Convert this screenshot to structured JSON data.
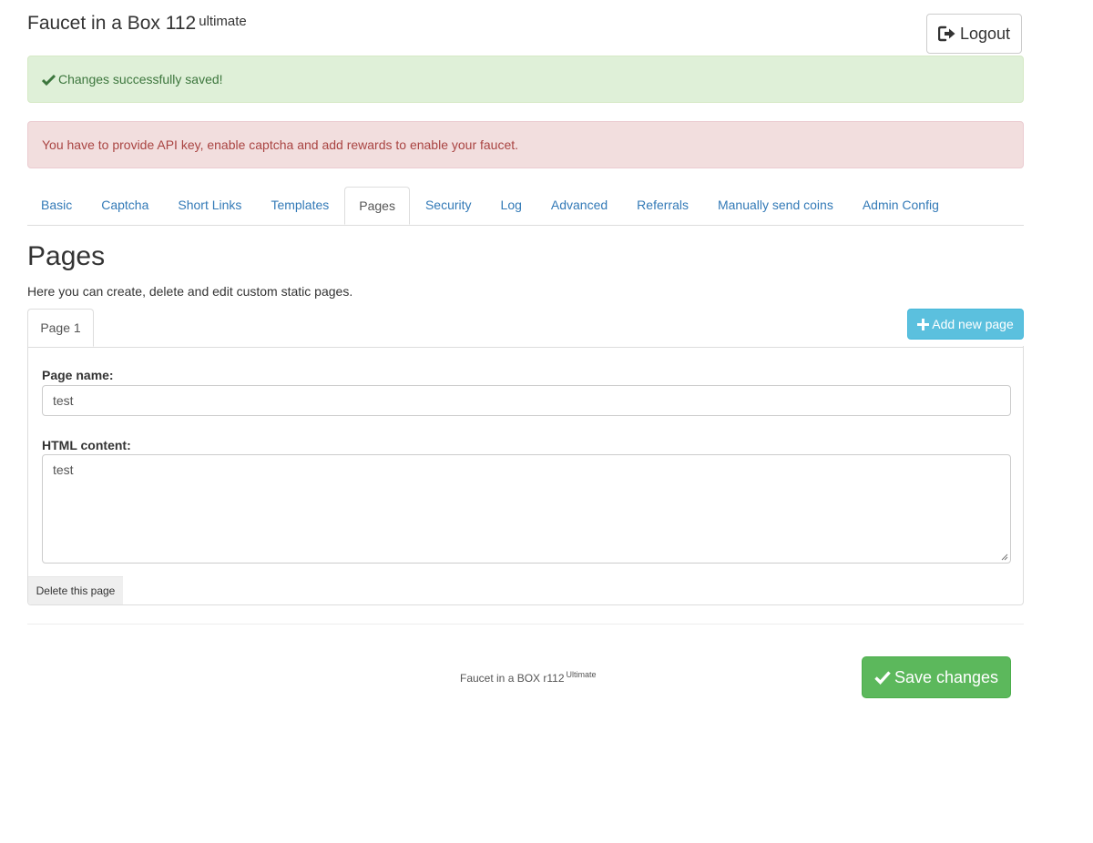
{
  "header": {
    "title": "Faucet in a Box 112",
    "title_sup": "ultimate",
    "logout_label": "Logout"
  },
  "alerts": {
    "success": "Changes successfully saved!",
    "danger": "You have to provide API key, enable captcha and add rewards to enable your faucet."
  },
  "tabs": [
    {
      "label": "Basic"
    },
    {
      "label": "Captcha"
    },
    {
      "label": "Short Links"
    },
    {
      "label": "Templates"
    },
    {
      "label": "Pages",
      "active": true
    },
    {
      "label": "Security"
    },
    {
      "label": "Log"
    },
    {
      "label": "Advanced"
    },
    {
      "label": "Referrals"
    },
    {
      "label": "Manually send coins"
    },
    {
      "label": "Admin Config"
    }
  ],
  "pages_section": {
    "title": "Pages",
    "description": "Here you can create, delete and edit custom static pages.",
    "sub_tab_label": "Page 1",
    "add_label": "Add new page",
    "page_name_label": "Page name:",
    "page_name_value": "test",
    "html_content_label": "HTML content:",
    "html_content_value": "test",
    "delete_label": "Delete this page"
  },
  "footer": {
    "text": "Faucet in a BOX r112",
    "sup": "Ultimate",
    "save_label": "Save changes"
  },
  "colors": {
    "link": "#337ab7",
    "success_bg": "#dff0d8",
    "danger_bg": "#f2dede",
    "info_btn": "#5bc0de",
    "success_btn": "#5cb85c"
  }
}
